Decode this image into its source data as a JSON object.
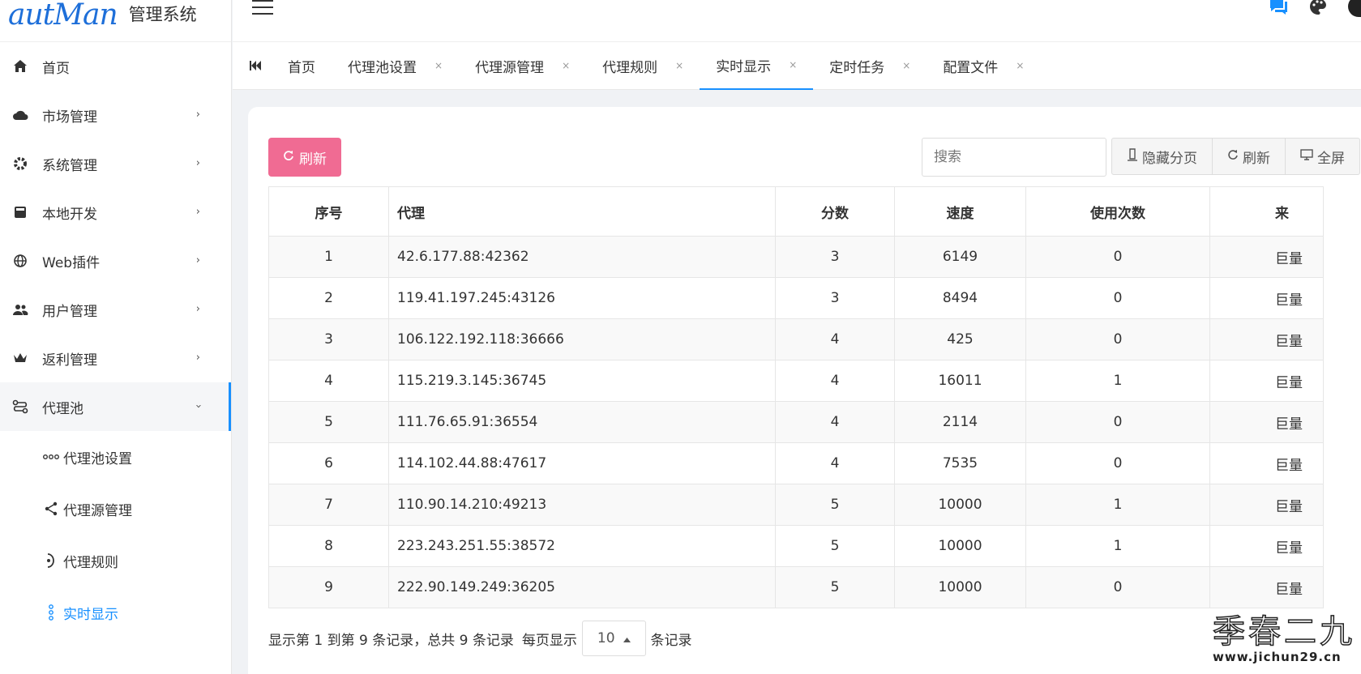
{
  "logo": {
    "script": "autMan",
    "title": "管理系统"
  },
  "sidebar": {
    "items": [
      {
        "label": "首页",
        "icon": "home-icon"
      },
      {
        "label": "市场管理",
        "icon": "cloud-icon",
        "arrow": "›"
      },
      {
        "label": "系统管理",
        "icon": "gear-icon",
        "arrow": "›"
      },
      {
        "label": "本地开发",
        "icon": "terminal-icon",
        "arrow": "›"
      },
      {
        "label": "Web插件",
        "icon": "globe-icon",
        "arrow": "›"
      },
      {
        "label": "用户管理",
        "icon": "users-icon",
        "arrow": "›"
      },
      {
        "label": "返利管理",
        "icon": "crown-icon",
        "arrow": "›"
      },
      {
        "label": "代理池",
        "icon": "proxy-icon",
        "arrow": "›"
      }
    ],
    "subitems": [
      {
        "label": "代理池设置",
        "icon": "dots-chain-icon"
      },
      {
        "label": "代理源管理",
        "icon": "share-nodes-icon"
      },
      {
        "label": "代理规则",
        "icon": "rule-icon"
      },
      {
        "label": "实时显示",
        "icon": "vertical-dots-icon"
      }
    ]
  },
  "tabs": {
    "first_icon": "first-page-icon",
    "items": [
      {
        "label": "首页",
        "close": ""
      },
      {
        "label": "代理池设置",
        "close": "×"
      },
      {
        "label": "代理源管理",
        "close": "×"
      },
      {
        "label": "代理规则",
        "close": "×"
      },
      {
        "label": "实时显示",
        "close": "×"
      },
      {
        "label": "定时任务",
        "close": "×"
      },
      {
        "label": "配置文件",
        "close": "×"
      }
    ]
  },
  "toolbar": {
    "refresh_label": "刷新",
    "search_placeholder": "搜索",
    "hide_paging": "隐藏分页",
    "refresh": "刷新",
    "fullscreen": "全屏"
  },
  "table": {
    "headers": [
      "序号",
      "代理",
      "分数",
      "速度",
      "使用次数",
      "来"
    ],
    "rows": [
      [
        "1",
        "42.6.177.88:42362",
        "3",
        "6149",
        "0",
        "巨量"
      ],
      [
        "2",
        "119.41.197.245:43126",
        "3",
        "8494",
        "0",
        "巨量"
      ],
      [
        "3",
        "106.122.192.118:36666",
        "4",
        "425",
        "0",
        "巨量"
      ],
      [
        "4",
        "115.219.3.145:36745",
        "4",
        "16011",
        "1",
        "巨量"
      ],
      [
        "5",
        "111.76.65.91:36554",
        "4",
        "2114",
        "0",
        "巨量"
      ],
      [
        "6",
        "114.102.44.88:47617",
        "4",
        "7535",
        "0",
        "巨量"
      ],
      [
        "7",
        "110.90.14.210:49213",
        "5",
        "10000",
        "1",
        "巨量"
      ],
      [
        "8",
        "223.243.251.55:38572",
        "5",
        "10000",
        "1",
        "巨量"
      ],
      [
        "9",
        "222.90.149.249:36205",
        "5",
        "10000",
        "0",
        "巨量"
      ]
    ]
  },
  "pager": {
    "summary": "显示第 1 到第 9 条记录，总共 9 条记录",
    "per_page_label": "每页显示",
    "page_size": "10",
    "records_suffix": "条记录"
  },
  "watermark": {
    "big": "季春二九",
    "small": "www.jichun29.cn"
  },
  "colors": {
    "accent": "#1890ff",
    "refresh_button": "#f06b93"
  }
}
